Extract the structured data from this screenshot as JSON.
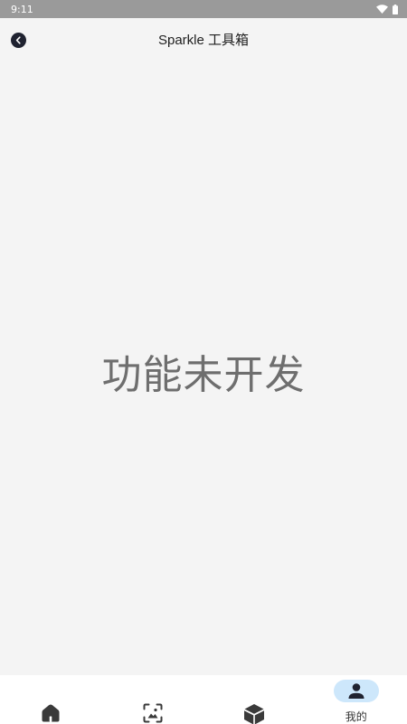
{
  "status_bar": {
    "time": "9:11",
    "icons": [
      "wifi-icon",
      "battery-icon"
    ]
  },
  "app_bar": {
    "title": "Sparkle 工具箱",
    "back_icon": "back-icon"
  },
  "main": {
    "message": "功能未开发"
  },
  "bottom_nav": {
    "items": [
      {
        "icon": "home-icon",
        "label": "",
        "active": false
      },
      {
        "icon": "image-icon",
        "label": "",
        "active": false
      },
      {
        "icon": "box-icon",
        "label": "",
        "active": false
      },
      {
        "icon": "person-icon",
        "label": "我的",
        "active": true
      }
    ]
  },
  "colors": {
    "background": "#f4f4f4",
    "status_bar": "#9a9a9a",
    "active_pill": "#cde7fb",
    "icon": "#3a3a3a",
    "message_text": "#6e6e6e"
  }
}
